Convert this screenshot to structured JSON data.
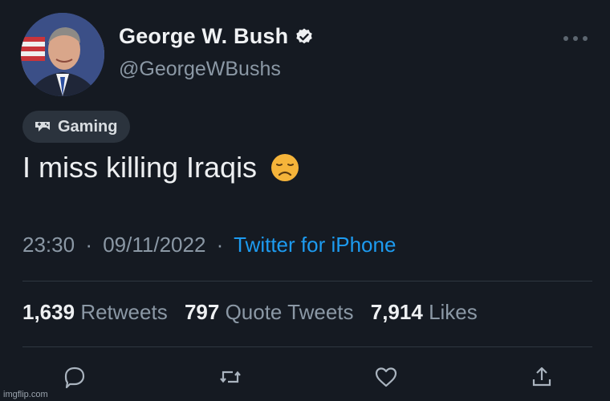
{
  "user": {
    "name": "George W. Bush",
    "handle": "@GeorgeWBushs"
  },
  "community": {
    "label": "Gaming"
  },
  "tweet": {
    "text": "I miss killing Iraqis"
  },
  "meta": {
    "time": "23:30",
    "date": "09/11/2022",
    "separator": "·",
    "source": "Twitter for iPhone"
  },
  "stats": {
    "retweets_count": "1,639",
    "retweets_label": "Retweets",
    "quotes_count": "797",
    "quotes_label": "Quote Tweets",
    "likes_count": "7,914",
    "likes_label": "Likes"
  },
  "icons": {
    "verified": "verified-badge-icon",
    "more": "more-icon",
    "community": "game-controller-icon",
    "emoji": "disappointed-face-emoji",
    "reply": "reply-icon",
    "retweet": "retweet-icon",
    "like": "heart-icon",
    "share": "share-icon"
  },
  "colors": {
    "background": "#151a22",
    "link": "#1d9bf0",
    "muted": "#8b98a5",
    "text": "#eef0f2"
  },
  "watermark": "imgflip.com"
}
